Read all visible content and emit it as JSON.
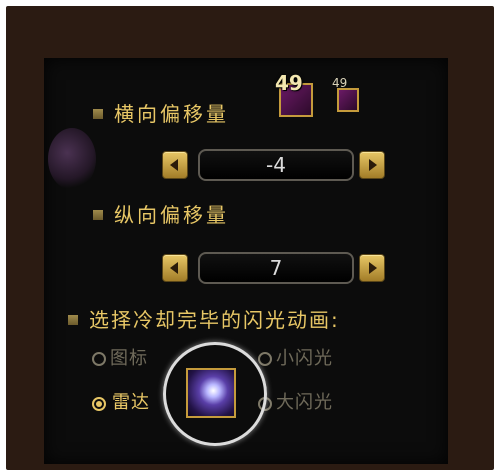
{
  "horizontal_offset": {
    "label": "横向偏移量",
    "value": "-4"
  },
  "vertical_offset": {
    "label": "纵向偏移量",
    "value": "7"
  },
  "preview_icons": {
    "large_count": "49",
    "small_count": "49"
  },
  "flash_animation": {
    "label": "选择冷却完毕的闪光动画:",
    "options": [
      {
        "label": "图标",
        "checked": false
      },
      {
        "label": "小闪光",
        "checked": false
      },
      {
        "label": "雷达",
        "checked": true
      },
      {
        "label": "大闪光",
        "checked": false
      }
    ]
  },
  "colors": {
    "gold": "#e8c766",
    "panel_bg": "#0c0c0c",
    "frame_bg": "#2b1b12",
    "disabled_text": "#6f6a5a"
  }
}
